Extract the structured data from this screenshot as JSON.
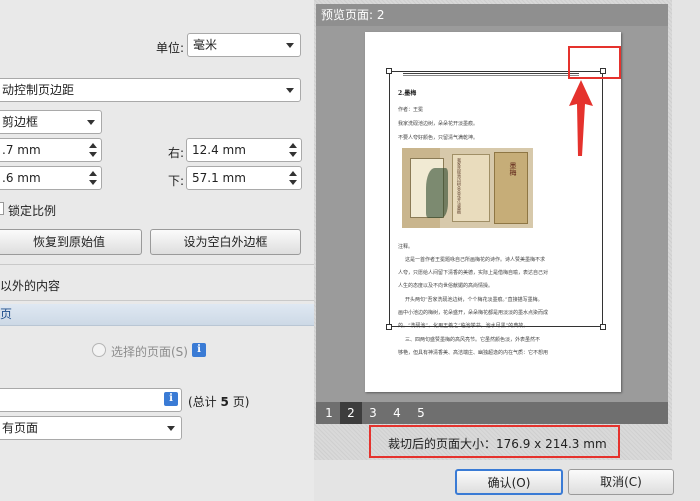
{
  "settings": {
    "unit_label": "单位:",
    "unit_value": "毫米",
    "margin_mode": "动控制页边距",
    "crop_box": "剪边框",
    "left_value": ".7 mm",
    "right_label": "右:",
    "right_value": "12.4 mm",
    "top_value": ".6 mm",
    "bottom_label": "下:",
    "bottom_value": "57.1 mm",
    "lock_ratio": "锁定比例",
    "restore_button": "恢复到原始值",
    "set_blank_button": "设为空白外边框",
    "outside_content": "以外的内容"
  },
  "page_range": {
    "section_title": "页",
    "selected_pages": "选择的页面(S)",
    "total_prefix": "(总计",
    "total_count": "5",
    "total_suffix": "页)",
    "apply_to": "有页面"
  },
  "preview": {
    "header": "预览页面: 2",
    "pages": [
      "1",
      "2",
      "3",
      "4",
      "5"
    ],
    "selected_page": "2",
    "crop_size_text": "裁切后的页面大小：176.9 x 214.3 mm"
  },
  "document": {
    "heading": "2.墨梅",
    "author": "作者：王冕",
    "line1": "我家洗砚池边树，朵朵花开淡墨痕。",
    "line2": "不要人夸好颜色，只留清气满乾坤。",
    "image_title": "墨梅",
    "image_poem": "我家洗砚池边树朵朵花开淡墨痕",
    "note_label": "注释。",
    "p1": "这是一首作者王冕题咏自己所画梅花的诗作。诗人赞美墨梅不求",
    "p2": "人夸，只愿给人间留下清香的美德，实际上是借梅自喻，表达自己对",
    "p3": "人生的态度以及不向世俗献媚的高尚情操。",
    "p4": "开头两句“吾家洗砚池边树，个个梅花淡墨痕。”直接描写墨梅。",
    "p5": "画中小池边的梅树，花朵盛开，朵朵梅花都是用淡淡的墨水点染而成",
    "p6": "的。“洗砚池”，化用王羲之“临池学书，池水尽黑”的典故。",
    "p7": "三、四两句盛赞墨梅的高风亮节。它虽然颜色淡，外表虽然不",
    "p8": "够艳，但具有神清香美、高洁端庄、幽独超逸的内在气质：它不想用"
  },
  "dialog": {
    "ok_button": "确认(O)",
    "cancel_button": "取消(C)"
  },
  "colors": {
    "highlight": "#e5322d",
    "info_blue": "#3a7bd5",
    "section_blue": "#1f4e8c"
  }
}
